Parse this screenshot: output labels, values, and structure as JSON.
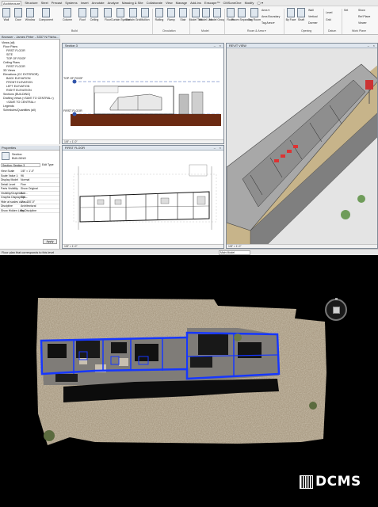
{
  "menu": {
    "tabs": [
      "Architecture",
      "Structure",
      "Steel",
      "Precast",
      "Systems",
      "Insert",
      "Annotate",
      "Analyze",
      "Massing & Site",
      "Collaborate",
      "View",
      "Manage",
      "Add-Ins",
      "Enscape™",
      "CMSoneOne",
      "Modify",
      "◯ ▾"
    ]
  },
  "ribbon": {
    "build_buttons": [
      "Wall",
      "Door",
      "Window",
      "Component",
      "Column",
      "Roof",
      "Ceiling",
      "Floor",
      "Curtain System",
      "Curtain Grid",
      "Mullion"
    ],
    "circulation_buttons": [
      "Railing",
      "Ramp",
      "Stair"
    ],
    "model_buttons": [
      "Model Text",
      "Model Line",
      "Model Group"
    ],
    "room_buttons": [
      "Room",
      "Room Separator",
      "Tag Room"
    ],
    "room_small": [
      "Area ▾",
      "Area Boundary",
      "Tag Area ▾"
    ],
    "opening_buttons": [
      "By Face",
      "Shaft",
      "Wall"
    ],
    "opening_small": [
      "Vertical",
      "Dormer"
    ],
    "datum_small": [
      "Level",
      "Grid"
    ],
    "workplane_small": [
      "Set",
      "Show",
      "Ref Plane",
      "Viewer"
    ],
    "panels": {
      "build": "Build",
      "circulation": "Circulation",
      "model": "Model",
      "room": "Room & Area ▾",
      "opening": "Opening",
      "datum": "Datum",
      "workplane": "Work Plane"
    }
  },
  "browser": {
    "title": "Browser - James Peter - 3337 N Fitzhu...",
    "items": [
      "Views (all)",
      "Floor Plans",
      "FIRST FLOOR",
      "SITE",
      "TOP OF ROOF",
      "Ceiling Plans",
      "FIRST FLOOR",
      "3D Views",
      "Elevations (CC EXTERIOR)",
      "BACK ELEVATION",
      "FRONT ELEVATION",
      "LEFT ELEVATION",
      "RIGHT ELEVATION",
      "Sections (BUILDING)",
      "Drafting Views (<SAVE TO CENTRAL>)",
      "<SAVE TO CENTRAL>",
      "Legends",
      "Schedules/Quantities (all)"
    ]
  },
  "properties": {
    "title": "Properties",
    "type_name": "Section",
    "type_sub": "BUILDING",
    "selector": "Section: Section 3",
    "edit_type": "Edit Type",
    "rows": [
      {
        "k": "View Scale",
        "v": "1/8\" = 1'-0\""
      },
      {
        "k": "Scale Value 1:",
        "v": "96"
      },
      {
        "k": "Display Model",
        "v": "Normal"
      },
      {
        "k": "Detail Level",
        "v": "Fine"
      },
      {
        "k": "Parts Visibility",
        "v": "Show Original"
      },
      {
        "k": "Visibility/Graphics...",
        "v": "Edit..."
      },
      {
        "k": "Graphic Display Op...",
        "v": "Edit..."
      },
      {
        "k": "Hide at scales coars...",
        "v": "1\" = 400'-0\""
      },
      {
        "k": "Discipline",
        "v": "Architectural"
      },
      {
        "k": "Show Hidden Lines",
        "v": "By Discipline"
      }
    ],
    "apply": "Apply"
  },
  "views": {
    "section": {
      "title": "Section 3",
      "tag1": "TOP OF ROOF",
      "tag2": "FIRST FLOOR",
      "scale": "1/8\" = 1'-0\""
    },
    "plan": {
      "title": "FIRST FLOOR",
      "scale": "1/8\" = 1'-0\""
    },
    "threed": {
      "title": "REVIT VIEW",
      "scale": "1/8\" = 1'-0\""
    }
  },
  "status": {
    "text": "Floor plan that corresponds to this level",
    "model": "Main Model"
  },
  "scan": {
    "compass_icon": "navigation-cube-icon"
  },
  "logo": {
    "text": "DCMS",
    "mark_icon": "barcode-logo-icon"
  }
}
